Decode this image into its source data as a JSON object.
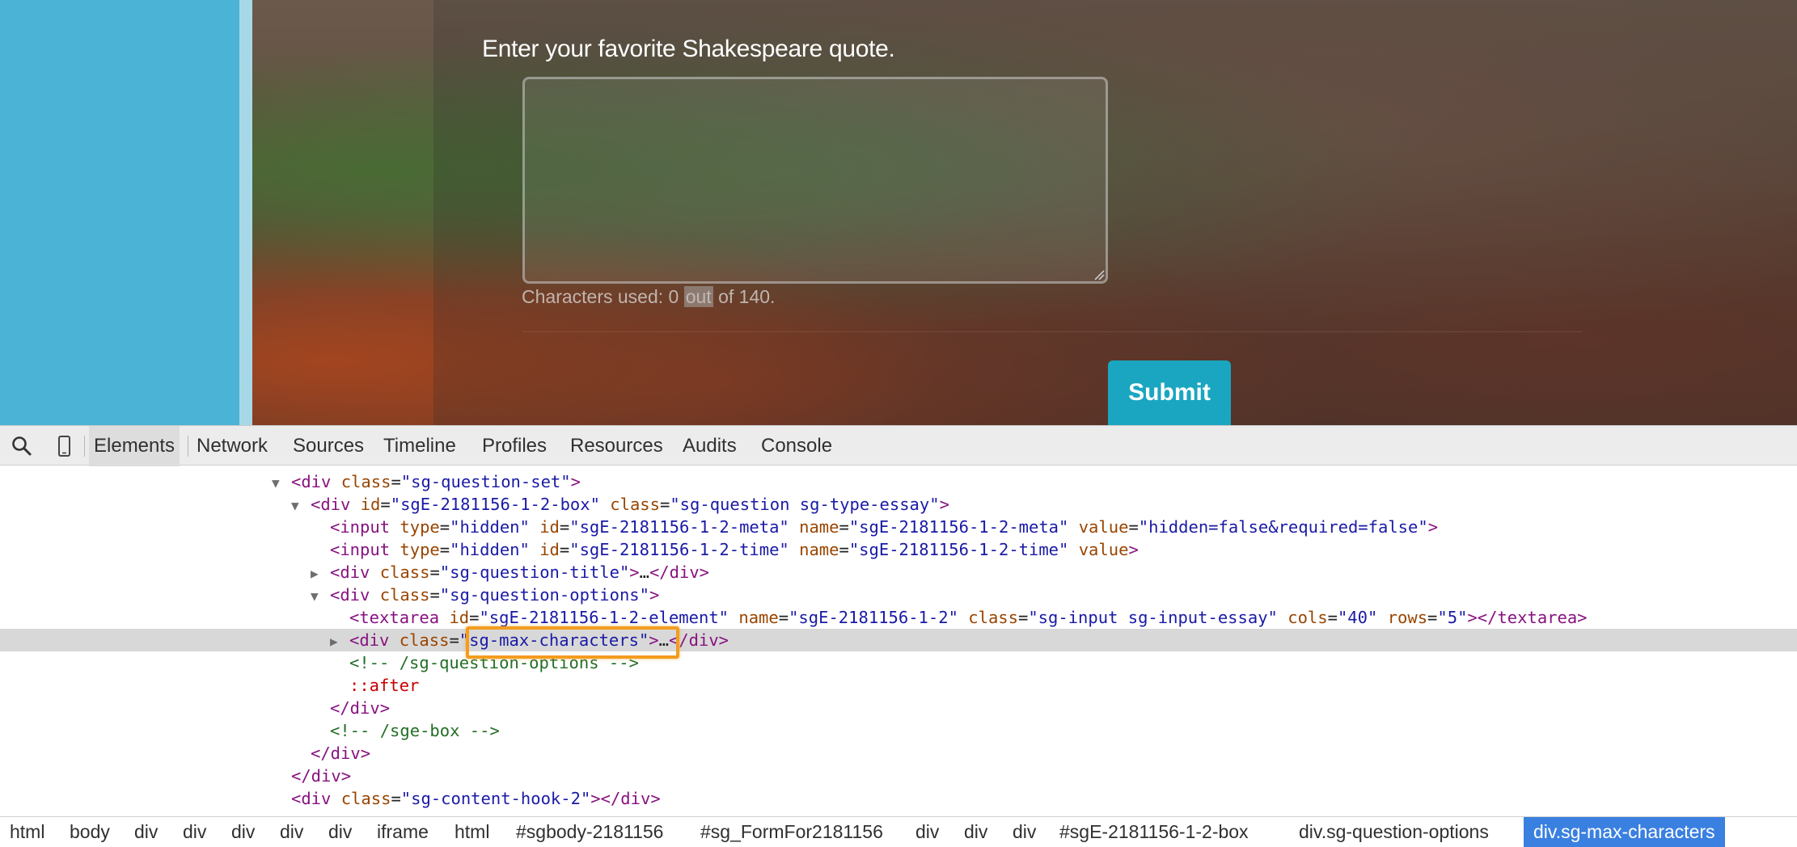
{
  "survey": {
    "question_title": "Enter your favorite Shakespeare quote.",
    "essay_value": "",
    "char_count_prefix": "Characters used: 0",
    "char_count_highlight": "out",
    "char_count_suffix": "of 140.",
    "submit_label": "Submit"
  },
  "devtools": {
    "tabs": [
      {
        "label": "Elements",
        "active": true
      },
      {
        "label": "Network",
        "active": false
      },
      {
        "label": "Sources",
        "active": false
      },
      {
        "label": "Timeline",
        "active": false
      },
      {
        "label": "Profiles",
        "active": false
      },
      {
        "label": "Resources",
        "active": false
      },
      {
        "label": "Audits",
        "active": false
      },
      {
        "label": "Console",
        "active": false
      }
    ],
    "icons": {
      "search": "search-icon",
      "device": "device-mode-icon"
    },
    "tree": {
      "l1": {
        "tag_open": "<div",
        "a1": "class",
        "v1": "\"sg-question-set\"",
        "tag_close": ">"
      },
      "l2": {
        "tag_open": "<div",
        "a1": "id",
        "v1": "\"sgE-2181156-1-2-box\"",
        "a2": "class",
        "v2": "\"sg-question sg-type-essay\"",
        "tag_close": ">"
      },
      "l3": {
        "tag_open": "<input",
        "a1": "type",
        "v1": "\"hidden\"",
        "a2": "id",
        "v2": "\"sgE-2181156-1-2-meta\"",
        "a3": "name",
        "v3": "\"sgE-2181156-1-2-meta\"",
        "a4": "value",
        "v4": "\"hidden=false&required=false\"",
        "tag_close": ">"
      },
      "l4": {
        "tag_open": "<input",
        "a1": "type",
        "v1": "\"hidden\"",
        "a2": "id",
        "v2": "\"sgE-2181156-1-2-time\"",
        "a3": "name",
        "v3": "\"sgE-2181156-1-2-time\"",
        "a4": "value",
        "tag_close": ">"
      },
      "l5": {
        "tag_open": "<div",
        "a1": "class",
        "v1": "\"sg-question-title\"",
        "tag_gt": ">",
        "ellipsis": "…",
        "tag_end": "</div>"
      },
      "l6": {
        "tag_open": "<div",
        "a1": "class",
        "v1": "\"sg-question-options\"",
        "tag_close": ">"
      },
      "l7": {
        "tag_open": "<textarea",
        "a1": "id",
        "v1": "\"sgE-2181156-1-2-element\"",
        "a2": "name",
        "v2": "\"sgE-2181156-1-2\"",
        "a3": "class",
        "v3": "\"sg-input sg-input-essay\"",
        "a4": "cols",
        "v4": "\"40\"",
        "a5": "rows",
        "v5": "\"5\"",
        "tag_close": "></textarea>"
      },
      "l8": {
        "tag_open": "<div",
        "a1": "class",
        "v1": "\"sg-max-characters\"",
        "tag_gt": ">",
        "ellipsis": "…",
        "tag_end": "</div>"
      },
      "l9": {
        "comment": "<!-- /sg-question-options -->"
      },
      "l10": {
        "pseudo": "::after"
      },
      "l11": {
        "tag_end": "</div>"
      },
      "l12": {
        "comment": "<!-- /sge-box -->"
      },
      "l13": {
        "tag_end": "</div>"
      },
      "l14": {
        "tag_end": "</div>"
      },
      "l15": {
        "tag_open": "<div",
        "a1": "class",
        "v1": "\"sg-content-hook-2\"",
        "tag_close": "></div>"
      }
    },
    "breadcrumbs": [
      "html",
      "body",
      "div",
      "div",
      "div",
      "div",
      "div",
      "iframe",
      "html",
      "#sgbody-2181156",
      "#sg_FormFor2181156",
      "div",
      "div",
      "div",
      "#sgE-2181156-1-2-box",
      "div.sg-question-options",
      "div.sg-max-characters"
    ],
    "colors": {
      "tag": "#881280",
      "attr_name": "#994500",
      "attr_value": "#1a1aa6",
      "comment": "#236e25",
      "pseudo": "#c80000",
      "crumb_active": "#3a80e0",
      "highlight": "#f39c1f",
      "submit": "#1aa6c0",
      "sidebar_blue": "#4ab3d6"
    }
  }
}
